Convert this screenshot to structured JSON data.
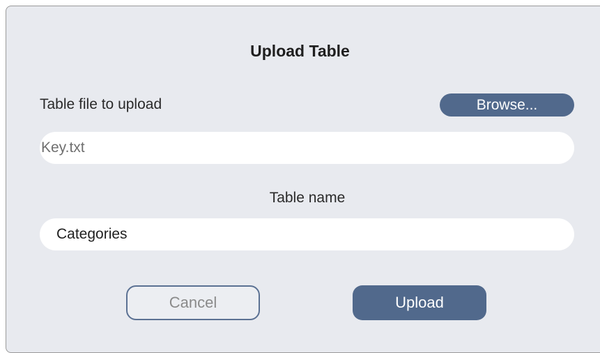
{
  "dialog": {
    "title": "Upload Table",
    "file_label": "Table file to upload",
    "browse_label": "Browse...",
    "file_value": "Key.txt",
    "name_label": "Table name",
    "name_value": "Categories",
    "cancel_label": "Cancel",
    "upload_label": "Upload"
  },
  "colors": {
    "accent": "#51698c",
    "dialog_background": "#e8eaef"
  }
}
